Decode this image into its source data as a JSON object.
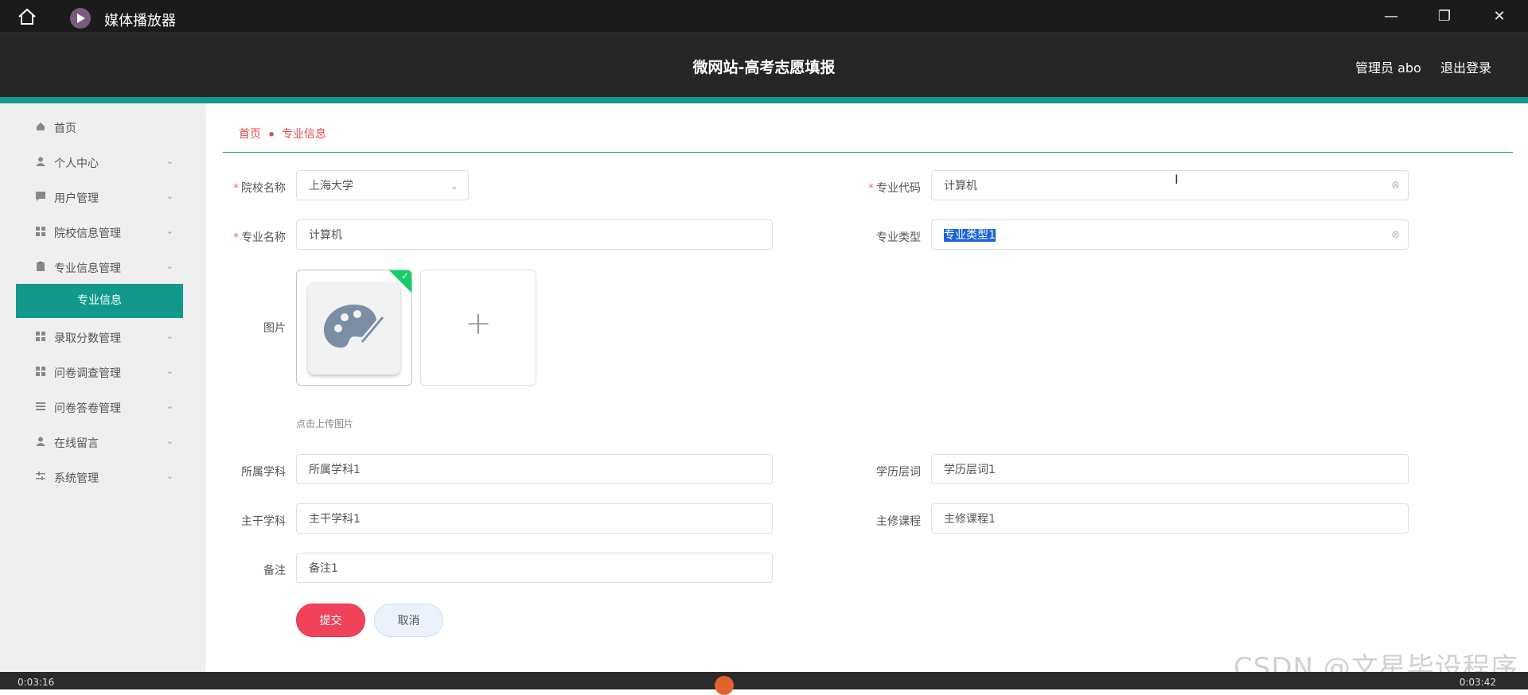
{
  "titlebar": {
    "app_name": "媒体播放器"
  },
  "header": {
    "site_title": "微网站-高考志愿填报",
    "admin_label": "管理员 abo",
    "logout_label": "退出登录"
  },
  "sidebar": {
    "items": [
      {
        "label": "首页",
        "icon": "home-icon"
      },
      {
        "label": "个人中心",
        "icon": "user-icon"
      },
      {
        "label": "用户管理",
        "icon": "chat-icon"
      },
      {
        "label": "院校信息管理",
        "icon": "grid-icon"
      },
      {
        "label": "专业信息管理",
        "icon": "clipboard-icon"
      },
      {
        "label": "录取分数管理",
        "icon": "grid-icon"
      },
      {
        "label": "问卷调查管理",
        "icon": "grid-icon"
      },
      {
        "label": "问卷答卷管理",
        "icon": "list-icon"
      },
      {
        "label": "在线留言",
        "icon": "user-icon"
      },
      {
        "label": "系统管理",
        "icon": "sliders-icon"
      }
    ],
    "active_sub": "专业信息"
  },
  "breadcrumb": {
    "home": "首页",
    "current": "专业信息"
  },
  "form": {
    "school_label": "院校名称",
    "school_value": "上海大学",
    "code_label": "专业代码",
    "code_value": "计算机",
    "major_label": "专业名称",
    "major_value": "计算机",
    "type_label": "专业类型",
    "type_value": "专业类型1",
    "image_label": "图片",
    "upload_tip": "点击上传图片",
    "discipline_label": "所属学科",
    "discipline_value": "所属学科1",
    "level_label": "学历层词",
    "level_value": "学历层词1",
    "main_label": "主干学科",
    "main_value": "主干学科1",
    "course_label": "主修课程",
    "course_value": "主修课程1",
    "note_label": "备注",
    "note_value": "备注1",
    "submit_label": "提交",
    "cancel_label": "取消"
  },
  "player": {
    "time_left": "0:03:16",
    "time_right": "0:03:42"
  },
  "watermark": "CSDN @文星毕设程序",
  "colors": {
    "teal": "#12998b",
    "submit": "#f0435a",
    "header": "#262626"
  }
}
